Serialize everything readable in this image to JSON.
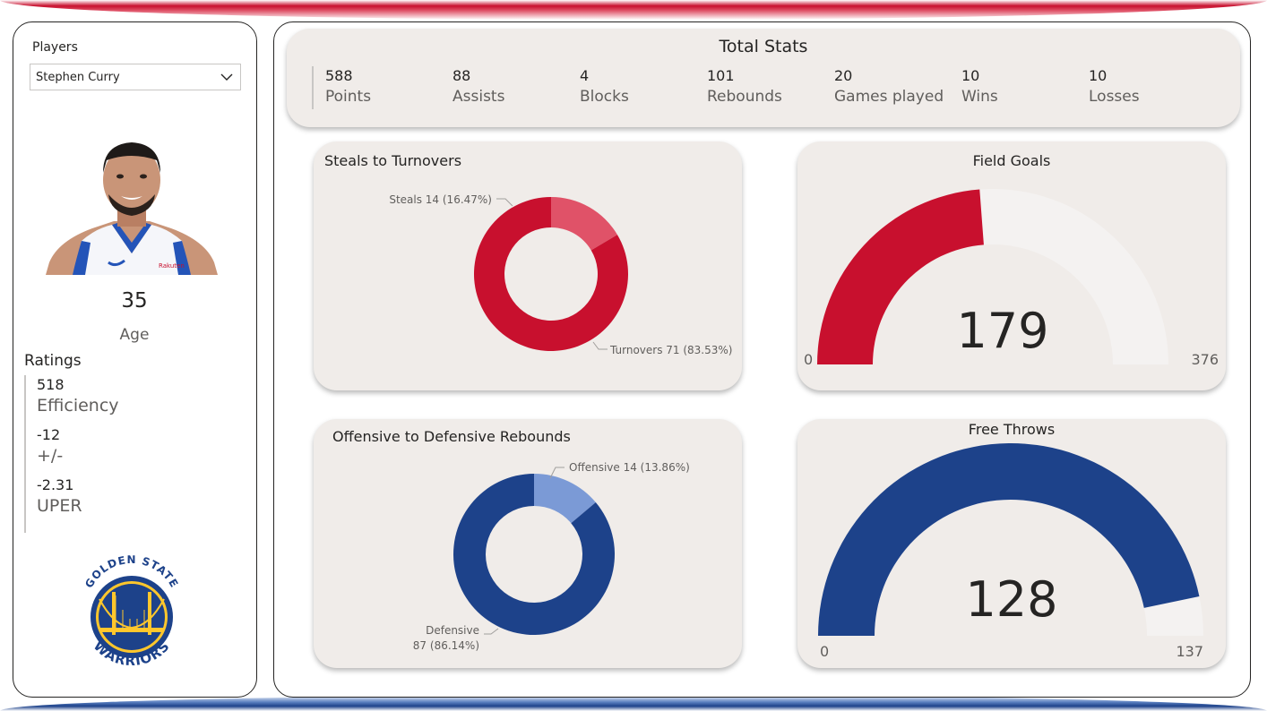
{
  "sidebar": {
    "players_label": "Players",
    "selected_player": "Stephen Curry",
    "age_value": "35",
    "age_label": "Age",
    "ratings_title": "Ratings",
    "ratings": [
      {
        "value": "518",
        "label": "Efficiency"
      },
      {
        "value": "-12",
        "label": "+/-"
      },
      {
        "value": "-2.31",
        "label": "UPER"
      }
    ],
    "team_logo_text_top": "GOLDEN STATE",
    "team_logo_text_bottom": "WARRIORS"
  },
  "total_stats": {
    "title": "Total Stats",
    "items": [
      {
        "value": "588",
        "label": "Points"
      },
      {
        "value": "88",
        "label": "Assists"
      },
      {
        "value": "4",
        "label": "Blocks"
      },
      {
        "value": "101",
        "label": "Rebounds"
      },
      {
        "value": "20",
        "label": "Games played"
      },
      {
        "value": "10",
        "label": "Wins"
      },
      {
        "value": "10",
        "label": "Losses"
      }
    ]
  },
  "colors": {
    "red": "#c8102e",
    "red_light": "#e05268",
    "blue": "#1d428a",
    "blue_light": "#7b9ad6",
    "card_bg": "#f0ece9",
    "gauge_track": "#f4f2f1"
  },
  "chart_data": [
    {
      "type": "donut",
      "title": "Steals to Turnovers",
      "slices": [
        {
          "name": "Steals",
          "value": 14,
          "label": "Steals 14 (16.47%)"
        },
        {
          "name": "Turnovers",
          "value": 71,
          "label": "Turnovers 71 (83.53%)"
        }
      ]
    },
    {
      "type": "gauge",
      "title": "Field Goals",
      "value": 179,
      "min": 0,
      "max": 376,
      "value_label": "179",
      "min_label": "0",
      "max_label": "376"
    },
    {
      "type": "donut",
      "title": "Offensive to Defensive Rebounds",
      "slices": [
        {
          "name": "Offensive",
          "value": 14,
          "label": "Offensive 14 (13.86%)"
        },
        {
          "name": "Defensive",
          "value": 87,
          "label_line1": "Defensive",
          "label_line2": "87 (86.14%)"
        }
      ]
    },
    {
      "type": "gauge",
      "title": "Free Throws",
      "value": 128,
      "min": 0,
      "max": 137,
      "value_label": "128",
      "min_label": "0",
      "max_label": "137"
    }
  ]
}
